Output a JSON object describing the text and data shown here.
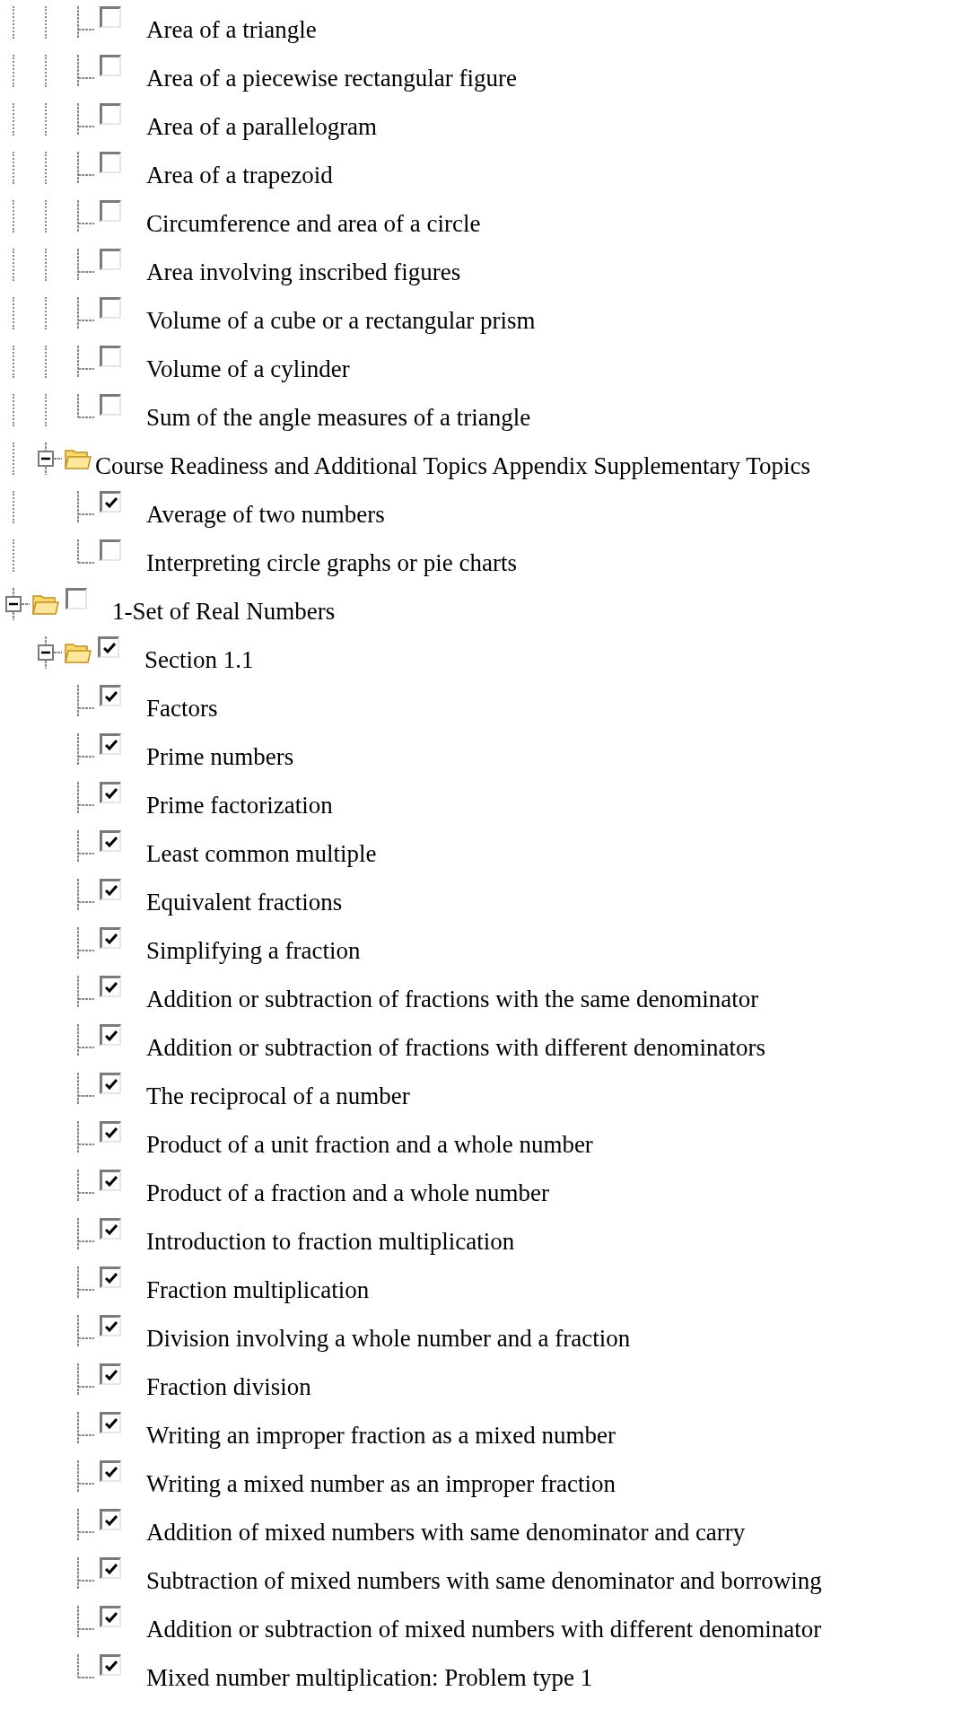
{
  "tree": [
    {
      "children": [
        {
          "children": [
            {
              "label": "Area of a triangle",
              "checked": false
            },
            {
              "label": "Area of a piecewise rectangular figure",
              "checked": false
            },
            {
              "label": "Area of a parallelogram",
              "checked": false
            },
            {
              "label": "Area of a trapezoid",
              "checked": false
            },
            {
              "label": "Circumference and area of a circle",
              "checked": false
            },
            {
              "label": "Area involving inscribed figures",
              "checked": false
            },
            {
              "label": "Volume of a cube or a rectangular prism",
              "checked": false
            },
            {
              "label": "Volume of a cylinder",
              "checked": false
            },
            {
              "label": "Sum of the angle measures of a triangle",
              "checked": false
            }
          ]
        },
        {
          "label": "Course Readiness and Additional Topics Appendix Supplementary Topics",
          "expanded": true,
          "children": [
            {
              "label": "Average of two numbers",
              "checked": true
            },
            {
              "label": "Interpreting circle graphs or pie charts",
              "checked": false
            }
          ]
        }
      ]
    },
    {
      "label": "1-Set of Real Numbers",
      "checked": false,
      "expanded": true,
      "children": [
        {
          "label": "Section 1.1",
          "checked": true,
          "expanded": true,
          "children": [
            {
              "label": "Factors",
              "checked": true
            },
            {
              "label": "Prime numbers",
              "checked": true
            },
            {
              "label": "Prime factorization",
              "checked": true
            },
            {
              "label": "Least common multiple",
              "checked": true
            },
            {
              "label": "Equivalent fractions",
              "checked": true
            },
            {
              "label": "Simplifying a fraction",
              "checked": true
            },
            {
              "label": "Addition or subtraction of fractions with the same denominator",
              "checked": true
            },
            {
              "label": "Addition or subtraction of fractions with different denominators",
              "checked": true
            },
            {
              "label": "The reciprocal of a number",
              "checked": true
            },
            {
              "label": "Product of a unit fraction and a whole number",
              "checked": true
            },
            {
              "label": "Product of a fraction and a whole number",
              "checked": true
            },
            {
              "label": "Introduction to fraction multiplication",
              "checked": true
            },
            {
              "label": "Fraction multiplication",
              "checked": true
            },
            {
              "label": "Division involving a whole number and a fraction",
              "checked": true
            },
            {
              "label": "Fraction division",
              "checked": true
            },
            {
              "label": "Writing an improper fraction as a mixed number",
              "checked": true
            },
            {
              "label": "Writing a mixed number as an improper fraction",
              "checked": true
            },
            {
              "label": "Addition of mixed numbers with same denominator and carry",
              "checked": true
            },
            {
              "label": "Subtraction of mixed numbers with same denominator and borrowing",
              "checked": true
            },
            {
              "label": "Addition or subtraction of mixed numbers with different denominator",
              "checked": true
            },
            {
              "label": "Mixed number multiplication: Problem type 1",
              "checked": true
            }
          ]
        }
      ]
    }
  ]
}
